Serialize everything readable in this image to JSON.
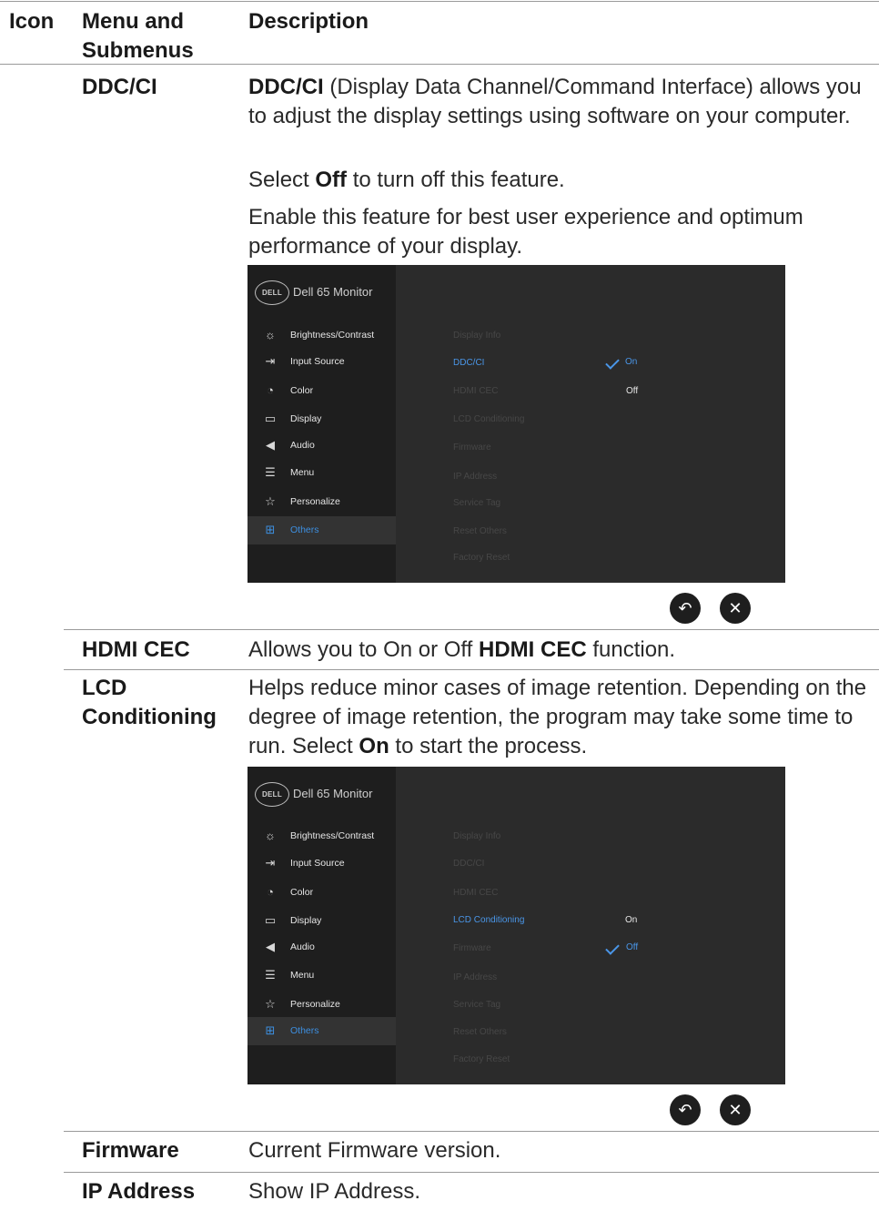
{
  "header": {
    "col_icon": "Icon",
    "col_menu": "Menu and Submenus",
    "col_desc": "Description"
  },
  "ddcci": {
    "term": "DDC/CI",
    "p1_bold": "DDC/CI",
    "p1_rest": " (Display Data Channel/Command Interface) allows you to adjust the display settings using software on your computer.",
    "p2_a": "Select ",
    "p2_bold": "Off",
    "p2_b": " to turn off this feature.",
    "p3": "Enable this feature for best user experience and optimum performance of your display."
  },
  "hdmicec": {
    "term": "HDMI CEC",
    "desc_a": "Allows you to On or Off ",
    "desc_bold": "HDMI CEC",
    "desc_b": " function."
  },
  "lcd": {
    "term": "LCD Conditioning",
    "desc_a": "Helps reduce minor cases of image retention. Depending on the degree of image retention, the program may take some time to run. Select ",
    "desc_bold": "On",
    "desc_b": " to start the process."
  },
  "firmware": {
    "term": "Firmware",
    "desc": "Current Firmware version."
  },
  "ipaddress": {
    "term": "IP Address",
    "desc": "Show IP Address."
  },
  "osd": {
    "logo": "DELL",
    "title": "Dell 65 Monitor",
    "menu": [
      {
        "label": "Brightness/Contrast",
        "icon": "brightness-icon"
      },
      {
        "label": "Input Source",
        "icon": "input-source-icon"
      },
      {
        "label": "Color",
        "icon": "color-icon"
      },
      {
        "label": "Display",
        "icon": "display-icon"
      },
      {
        "label": "Audio",
        "icon": "audio-icon"
      },
      {
        "label": "Menu",
        "icon": "menu-icon"
      },
      {
        "label": "Personalize",
        "icon": "star-icon"
      },
      {
        "label": "Others",
        "icon": "others-icon"
      }
    ],
    "submenu": [
      "Display Info",
      "DDC/CI",
      "HDMI CEC",
      "LCD Conditioning",
      "Firmware",
      "IP Address",
      "Service Tag",
      "Reset Others",
      "Factory Reset"
    ],
    "opt_on": "On",
    "opt_off": "Off"
  }
}
